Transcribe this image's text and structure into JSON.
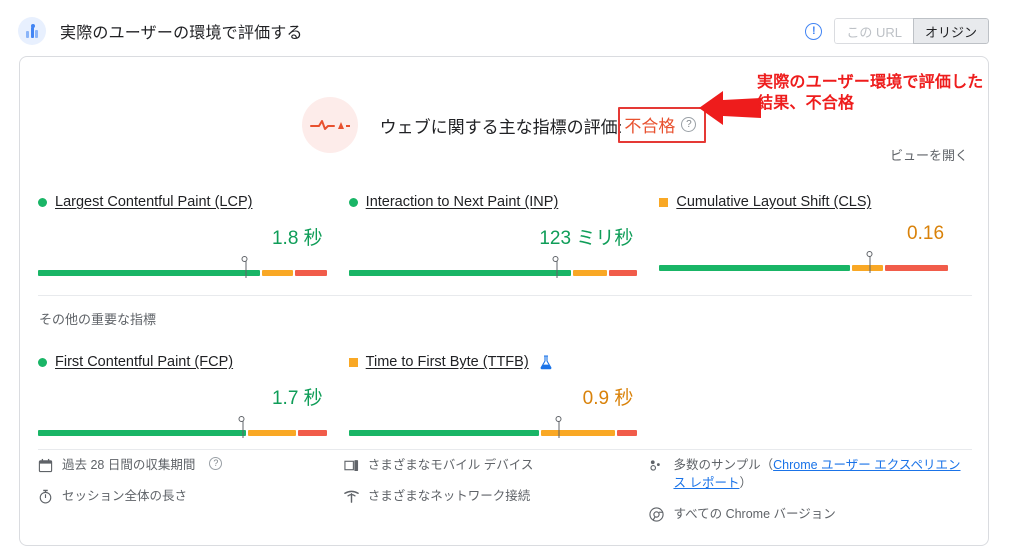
{
  "header": {
    "title": "実際のユーザーの環境で評価する",
    "icon": "user-experience-icon",
    "info_icon": "info-icon",
    "toggle": {
      "options": [
        {
          "label": "この URL",
          "selected": false,
          "disabled": true
        },
        {
          "label": "オリジン",
          "selected": true,
          "disabled": false
        }
      ]
    }
  },
  "assessment": {
    "icon": "failing-pulse-icon",
    "label": "ウェブに関する主な指標の評価:",
    "verdict": "不合格",
    "verdict_color": "#e8512f",
    "help_icon": "question-mark-icon",
    "annotation": "実際のユーザー環境で評価した結果、不合格",
    "annotation_color": "#ee1c1c",
    "arrow_icon": "left-arrow-annotation"
  },
  "open_view_label": "ビューを開く",
  "section_label": "その他の重要な指標",
  "metrics": {
    "primary": [
      {
        "name": "Largest Contentful Paint (LCP)",
        "status": "good",
        "status_shape": "circle",
        "status_color": "#19b566",
        "value": "1.8 秒",
        "marker_pct": 72,
        "segments": [
          {
            "rating": "good",
            "width_pct": 78
          },
          {
            "rating": "needs",
            "width_pct": 11
          },
          {
            "rating": "poor",
            "width_pct": 11
          }
        ]
      },
      {
        "name": "Interaction to Next Paint (INP)",
        "status": "good",
        "status_shape": "circle",
        "status_color": "#19b566",
        "value": "123 ミリ秒",
        "marker_pct": 72,
        "segments": [
          {
            "rating": "good",
            "width_pct": 78
          },
          {
            "rating": "needs",
            "width_pct": 12
          },
          {
            "rating": "poor",
            "width_pct": 10
          }
        ]
      },
      {
        "name": "Cumulative Layout Shift (CLS)",
        "status": "needs-improvement",
        "status_shape": "square",
        "status_color": "#f9a825",
        "value": "0.16",
        "marker_pct": 73,
        "segments": [
          {
            "rating": "good",
            "width_pct": 67
          },
          {
            "rating": "needs",
            "width_pct": 11
          },
          {
            "rating": "poor",
            "width_pct": 22
          }
        ]
      }
    ],
    "secondary": [
      {
        "name": "First Contentful Paint (FCP)",
        "status": "good",
        "status_shape": "circle",
        "status_color": "#19b566",
        "value": "1.7 秒",
        "marker_pct": 71,
        "experimental": false,
        "segments": [
          {
            "rating": "good",
            "width_pct": 73
          },
          {
            "rating": "needs",
            "width_pct": 17
          },
          {
            "rating": "poor",
            "width_pct": 10
          }
        ]
      },
      {
        "name": "Time to First Byte (TTFB)",
        "status": "needs-improvement",
        "status_shape": "square",
        "status_color": "#f9a825",
        "value": "0.9 秒",
        "marker_pct": 73,
        "experimental": true,
        "experimental_icon": "flask-icon",
        "segments": [
          {
            "rating": "good",
            "width_pct": 67
          },
          {
            "rating": "needs",
            "width_pct": 26
          },
          {
            "rating": "poor",
            "width_pct": 7
          }
        ]
      }
    ]
  },
  "footer": {
    "col1": [
      {
        "icon": "calendar-icon",
        "text": "過去 28 日間の収集期間",
        "help": true
      },
      {
        "icon": "timer-icon",
        "text": "セッション全体の長さ",
        "help": false
      }
    ],
    "col2": [
      {
        "icon": "mobile-device-icon",
        "text": "さまざまなモバイル デバイス"
      },
      {
        "icon": "network-signal-icon",
        "text": "さまざまなネットワーク接続"
      }
    ],
    "col3": {
      "samples": {
        "icon": "samples-icon",
        "prefix": "多数のサンプル（",
        "link": "Chrome ユーザー エクスペリエンス レポート",
        "suffix": "）"
      },
      "versions": {
        "icon": "chrome-icon",
        "text": "すべての Chrome バージョン"
      }
    }
  },
  "colors": {
    "good": "#19b566",
    "needs_improvement": "#f9a825",
    "poor": "#f15c4a",
    "link": "#1a73e8",
    "annotation_red": "#ee1c1c"
  }
}
